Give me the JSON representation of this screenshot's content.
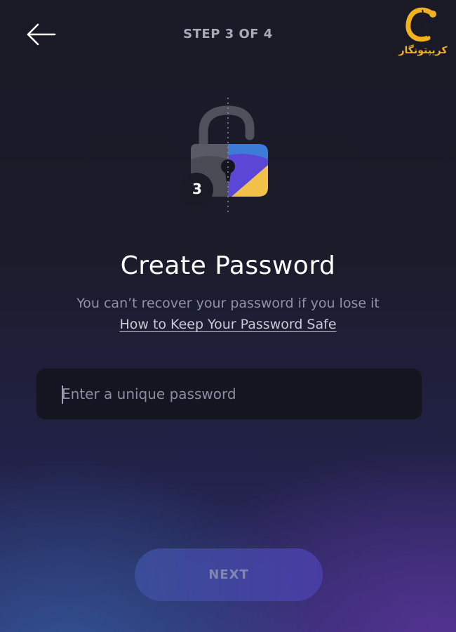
{
  "header": {
    "step_label": "STEP 3 OF 4"
  },
  "watermark": {
    "text": "کریپتونگار",
    "color": "#f2b21c"
  },
  "illustration": {
    "badge_number": "3"
  },
  "main": {
    "title": "Create Password",
    "subtitle": "You can’t recover your password if you lose it",
    "help_link": "How to Keep Your Password Safe"
  },
  "password_field": {
    "value": "",
    "placeholder": "Enter a unique password"
  },
  "footer": {
    "next_label": "NEXT"
  },
  "colors": {
    "background_top": "#1a1a26",
    "accent_purple": "#5b47d6",
    "accent_yellow": "#f2c14a",
    "accent_blue": "#3d7bd9"
  }
}
